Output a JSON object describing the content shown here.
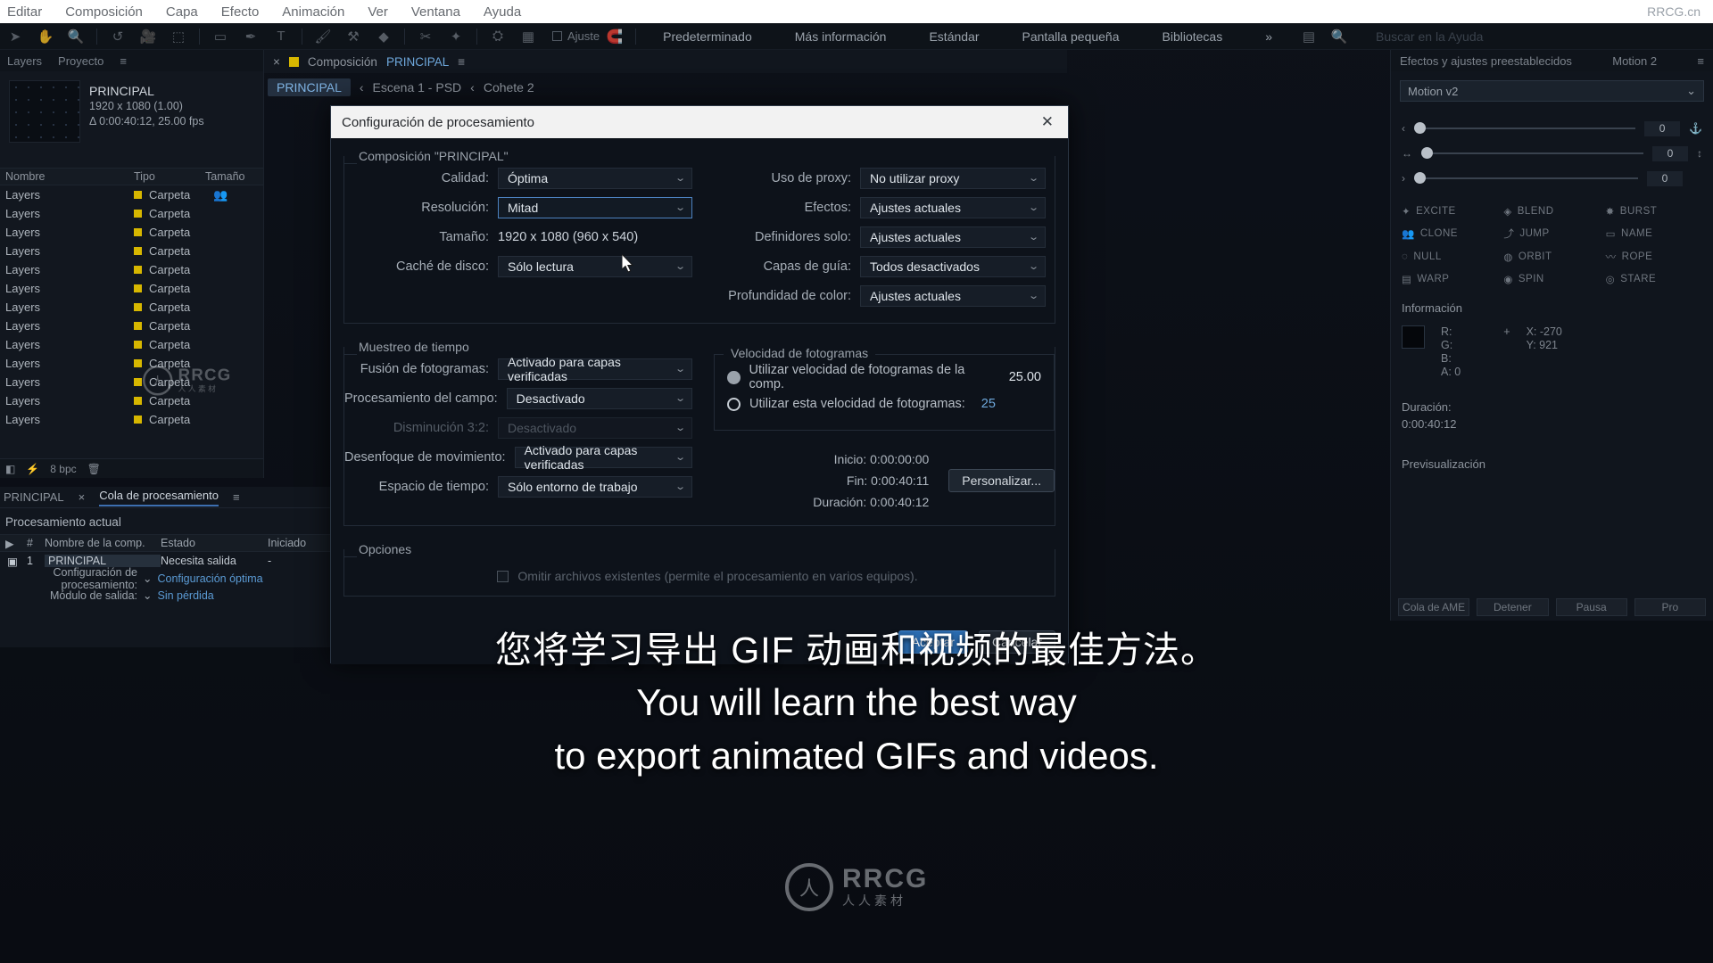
{
  "app": {
    "brand": "RRCG.cn",
    "menus": [
      "Editar",
      "Composición",
      "Capa",
      "Efecto",
      "Animación",
      "Ver",
      "Ventana",
      "Ayuda"
    ]
  },
  "toolbar": {
    "icons": [
      "arrow-icon",
      "hand-icon",
      "zoom-icon",
      "rotate-icon",
      "camera-icon",
      "pan-behind-icon",
      "shape-icon",
      "pen-icon",
      "text-icon",
      "brush-icon",
      "clone-stamp-icon",
      "eraser-icon",
      "roto-brush-icon",
      "puppet-pin-icon"
    ],
    "snap_label": "Ajuste",
    "workspaces": [
      "Predeterminado",
      "Más información",
      "Estándar",
      "Pantalla pequeña",
      "Bibliotecas"
    ],
    "overflow": "»",
    "search_placeholder": "Buscar en la Ayuda"
  },
  "project_panel": {
    "tabs": [
      "Layers",
      "Proyecto"
    ],
    "comp_name": "PRINCIPAL",
    "comp_dims": "1920 x 1080 (1.00)",
    "comp_duration": "Δ 0:00:40:12, 25.00 fps",
    "columns": [
      "Nombre",
      "Tipo",
      "Tamaño"
    ],
    "rows": [
      {
        "name": "Layers",
        "type": "Carpeta"
      },
      {
        "name": "Layers",
        "type": "Carpeta"
      },
      {
        "name": "Layers",
        "type": "Carpeta"
      },
      {
        "name": "Layers",
        "type": "Carpeta"
      },
      {
        "name": "Layers",
        "type": "Carpeta"
      },
      {
        "name": "Layers",
        "type": "Carpeta"
      },
      {
        "name": "Layers",
        "type": "Carpeta"
      },
      {
        "name": "Layers",
        "type": "Carpeta"
      },
      {
        "name": "Layers",
        "type": "Carpeta"
      },
      {
        "name": "Layers",
        "type": "Carpeta"
      },
      {
        "name": "Layers",
        "type": "Carpeta"
      },
      {
        "name": "Layers",
        "type": "Carpeta"
      },
      {
        "name": "Layers",
        "type": "Carpeta"
      }
    ],
    "bit_depth": "8 bpc"
  },
  "comp_strip": {
    "close": "×",
    "prefix": "Composición",
    "name": "PRINCIPAL",
    "menu": "≡"
  },
  "breadcrumb": {
    "current": "PRINCIPAL",
    "items": [
      "Escena 1 - PSD",
      "Cohete 2"
    ],
    "sep": "‹"
  },
  "render_queue": {
    "tabs": [
      "PRINCIPAL",
      "Cola de procesamiento"
    ],
    "close": "×",
    "menu": "≡",
    "title": "Procesamiento actual",
    "columns": [
      "Nombre de la comp.",
      "Estado",
      "Iniciado"
    ],
    "row": {
      "index": "1",
      "name": "PRINCIPAL",
      "status": "Necesita salida",
      "started": "-"
    },
    "settings_label": "Configuración de procesamiento:",
    "settings_value": "Configuración óptima",
    "module_label": "Módulo de salida:",
    "module_value": "Sin pérdida"
  },
  "right_panel": {
    "tabs": [
      "Efectos y ajustes preestablecidos",
      "Motion 2"
    ],
    "search_value": "Motion v2",
    "sliders": [
      {
        "value": "0"
      },
      {
        "value": "0"
      },
      {
        "value": "0"
      }
    ],
    "buttons": [
      "EXCITE",
      "BLEND",
      "BURST",
      "CLONE",
      "JUMP",
      "NAME",
      "NULL",
      "ORBIT",
      "ROPE",
      "WARP",
      "SPIN",
      "STARE"
    ],
    "info_title": "Información",
    "info_channels": [
      "R:",
      "G:",
      "B:",
      "A: 0"
    ],
    "info_x": "X: -270",
    "info_y": "Y: 921",
    "duration_label": "Duración:",
    "duration_value": "0:00:40:12",
    "preview_title": "Previsualización",
    "bottom_buttons": [
      "Cola de AME",
      "Detener",
      "Pausa",
      "Pro"
    ]
  },
  "modal": {
    "title": "Configuración de procesamiento",
    "close_icon": "✕",
    "section_comp": {
      "legend": "Composición \"PRINCIPAL\"",
      "left_rows": [
        {
          "label": "Calidad:",
          "value": "Óptima",
          "type": "select",
          "focused": false
        },
        {
          "label": "Resolución:",
          "value": "Mitad",
          "type": "select",
          "focused": true
        },
        {
          "label": "Tamaño:",
          "value": "1920 x 1080 (960 x 540)",
          "type": "text"
        },
        {
          "label": "Caché de disco:",
          "value": "Sólo lectura",
          "type": "select",
          "focused": false
        }
      ],
      "right_rows": [
        {
          "label": "Uso de proxy:",
          "value": "No utilizar proxy"
        },
        {
          "label": "Efectos:",
          "value": "Ajustes actuales"
        },
        {
          "label": "Definidores solo:",
          "value": "Ajustes actuales"
        },
        {
          "label": "Capas de guía:",
          "value": "Todos desactivados"
        },
        {
          "label": "Profundidad de color:",
          "value": "Ajustes actuales"
        }
      ]
    },
    "section_time": {
      "legend": "Muestreo de tiempo",
      "rows": [
        {
          "label": "Fusión de fotogramas:",
          "value": "Activado para capas verificadas",
          "disabled": false
        },
        {
          "label": "Procesamiento del campo:",
          "value": "Desactivado",
          "disabled": false
        },
        {
          "label": "Disminución 3:2:",
          "value": "Desactivado",
          "disabled": true
        },
        {
          "label": "Desenfoque de movimiento:",
          "value": "Activado para capas verificadas",
          "disabled": false
        },
        {
          "label": "Espacio de tiempo:",
          "value": "Sólo entorno de trabajo",
          "disabled": false
        }
      ],
      "framerate": {
        "legend": "Velocidad de fotogramas",
        "option_comp_label": "Utilizar velocidad de fotogramas de la comp.",
        "option_comp_value": "25.00",
        "option_comp_selected": true,
        "option_custom_label": "Utilizar esta velocidad de fotogramas:",
        "option_custom_value": "25",
        "option_custom_selected": false
      },
      "times": [
        {
          "label": "Inicio:",
          "value": "0:00:00:00"
        },
        {
          "label": "Fin:",
          "value": "0:00:40:11"
        },
        {
          "label": "Duración:",
          "value": "0:00:40:12"
        }
      ],
      "customize_button": "Personalizar..."
    },
    "section_options": {
      "legend": "Opciones",
      "checkbox_label": "Omitir archivos existentes (permite el procesamiento en varios equipos).",
      "checked": false
    },
    "ok_button": "Aceptar",
    "cancel_button": "Cancelar"
  },
  "subtitles": {
    "chinese": "您将学习导出 GIF 动画和视频的最佳方法。",
    "english_line1": "You will learn the best way",
    "english_line2": "to export animated GIFs and videos."
  },
  "watermark": {
    "line1": "RRCG",
    "line2": "人人素材",
    "glyph": "人"
  },
  "colors": {
    "accent": "#6ea8dc",
    "focus_border": "#4c82c0",
    "title_bar": "#f2f2f2",
    "modal_bg": "#0d121a",
    "folder_swatch": "#d7b700"
  }
}
